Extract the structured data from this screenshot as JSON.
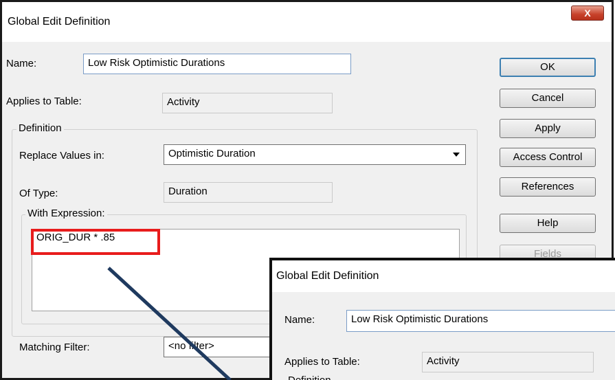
{
  "dialog": {
    "title": "Global Edit Definition",
    "close_glyph": "X",
    "name_label": "Name:",
    "name_value": "Low Risk Optimistic Durations",
    "applies_label": "Applies to Table:",
    "applies_value": "Activity",
    "definition_legend": "Definition",
    "replace_label": "Replace Values in:",
    "replace_value": "Optimistic Duration",
    "type_label": "Of Type:",
    "type_value": "Duration",
    "expression_legend": "With Expression:",
    "expression_value": "ORIG_DUR * .85",
    "matching_label": "Matching Filter:",
    "matching_value": "<no filter>"
  },
  "buttons": {
    "ok": "OK",
    "cancel": "Cancel",
    "apply": "Apply",
    "access_control": "Access Control",
    "references": "References",
    "help": "Help",
    "fields": "Fields"
  },
  "zoom_inset": {
    "title": "Global Edit Definition",
    "name_label": "Name:",
    "name_value": "Low Risk Optimistic Durations",
    "applies_label": "Applies to Table:",
    "applies_value": "Activity",
    "definition_legend": "Definition"
  },
  "annotation": {
    "highlight_color": "#e81c1c",
    "arrow_color": "#1f3a5f"
  }
}
